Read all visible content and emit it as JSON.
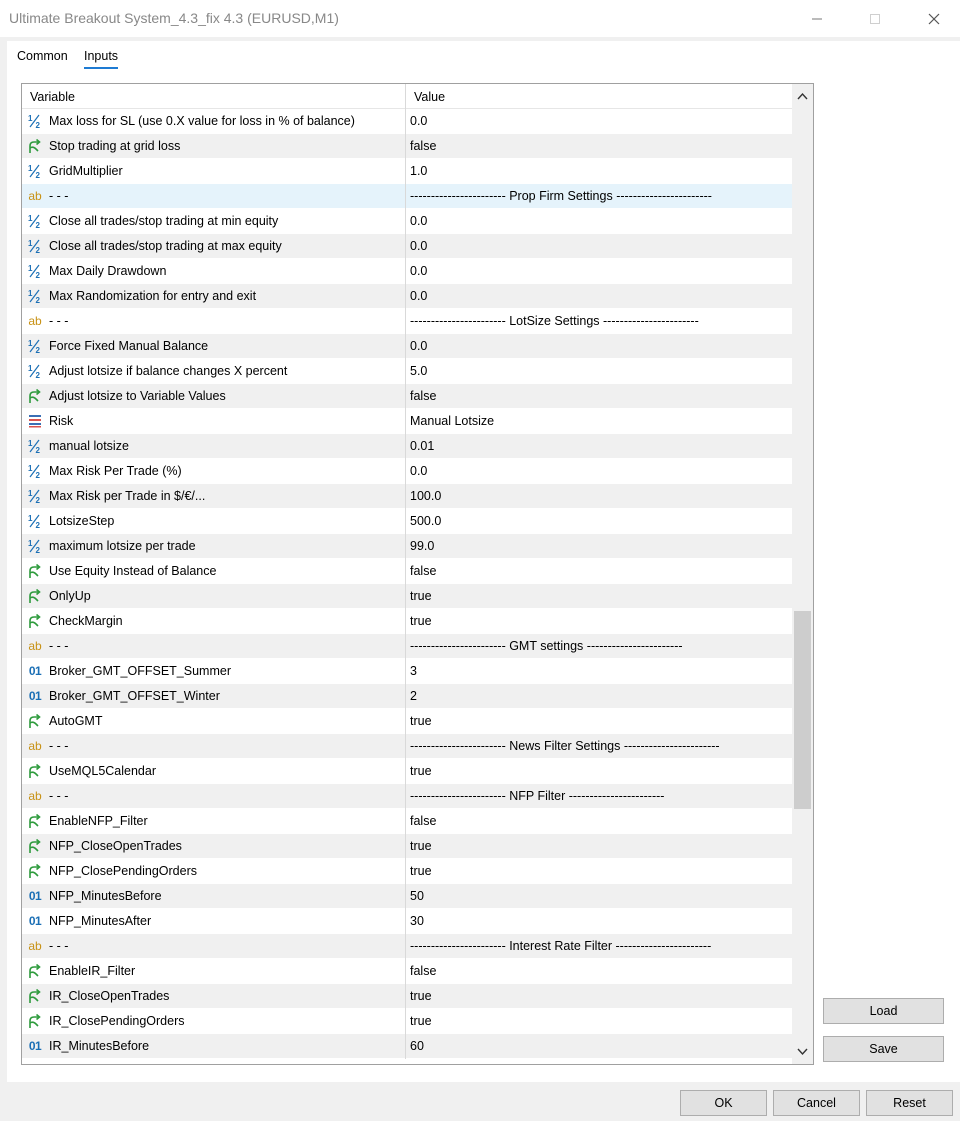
{
  "window": {
    "title": "Ultimate Breakout System_4.3_fix 4.3 (EURUSD,M1)"
  },
  "tabs": [
    {
      "label": "Common",
      "active": false
    },
    {
      "label": "Inputs",
      "active": true
    }
  ],
  "table": {
    "columns": [
      "Variable",
      "Value"
    ],
    "rows": [
      {
        "icon": "double",
        "name": "Max loss for SL (use 0.X value for loss in % of balance)",
        "value": "0.0"
      },
      {
        "icon": "bool",
        "name": "Stop trading at grid loss",
        "value": "false"
      },
      {
        "icon": "double",
        "name": "GridMultiplier",
        "value": "1.0"
      },
      {
        "icon": "string",
        "name": "- - -",
        "value": "----------------------- Prop Firm Settings -----------------------",
        "selected": true
      },
      {
        "icon": "double",
        "name": "Close all trades/stop trading at min equity",
        "value": "0.0"
      },
      {
        "icon": "double",
        "name": "Close all trades/stop trading at max equity",
        "value": "0.0"
      },
      {
        "icon": "double",
        "name": "Max Daily Drawdown",
        "value": "0.0"
      },
      {
        "icon": "double",
        "name": "Max Randomization for entry and exit",
        "value": "0.0"
      },
      {
        "icon": "string",
        "name": "- - -",
        "value": "----------------------- LotSize Settings -----------------------"
      },
      {
        "icon": "double",
        "name": "Force Fixed Manual Balance",
        "value": "0.0"
      },
      {
        "icon": "double",
        "name": "Adjust lotsize if balance changes X percent",
        "value": "5.0"
      },
      {
        "icon": "bool",
        "name": "Adjust lotsize to Variable Values",
        "value": "false"
      },
      {
        "icon": "enum",
        "name": "Risk",
        "value": "Manual Lotsize"
      },
      {
        "icon": "double",
        "name": "manual lotsize",
        "value": "0.01"
      },
      {
        "icon": "double",
        "name": "Max Risk Per Trade (%)",
        "value": "0.0"
      },
      {
        "icon": "double",
        "name": "Max Risk per Trade in $/€/...",
        "value": "100.0"
      },
      {
        "icon": "double",
        "name": "LotsizeStep",
        "value": "500.0"
      },
      {
        "icon": "double",
        "name": "maximum lotsize per trade",
        "value": "99.0"
      },
      {
        "icon": "bool",
        "name": "Use Equity Instead of Balance",
        "value": "false"
      },
      {
        "icon": "bool",
        "name": "OnlyUp",
        "value": "true"
      },
      {
        "icon": "bool",
        "name": "CheckMargin",
        "value": "true"
      },
      {
        "icon": "string",
        "name": "- - -",
        "value": "----------------------- GMT settings -----------------------"
      },
      {
        "icon": "int",
        "name": "Broker_GMT_OFFSET_Summer",
        "value": "3"
      },
      {
        "icon": "int",
        "name": "Broker_GMT_OFFSET_Winter",
        "value": "2"
      },
      {
        "icon": "bool",
        "name": "AutoGMT",
        "value": "true"
      },
      {
        "icon": "string",
        "name": "- - -",
        "value": "----------------------- News Filter Settings -----------------------"
      },
      {
        "icon": "bool",
        "name": "UseMQL5Calendar",
        "value": "true"
      },
      {
        "icon": "string",
        "name": "- - -",
        "value": "----------------------- NFP Filter -----------------------"
      },
      {
        "icon": "bool",
        "name": "EnableNFP_Filter",
        "value": "false"
      },
      {
        "icon": "bool",
        "name": "NFP_CloseOpenTrades",
        "value": "true"
      },
      {
        "icon": "bool",
        "name": "NFP_ClosePendingOrders",
        "value": "true"
      },
      {
        "icon": "int",
        "name": "NFP_MinutesBefore",
        "value": "50"
      },
      {
        "icon": "int",
        "name": "NFP_MinutesAfter",
        "value": "30"
      },
      {
        "icon": "string",
        "name": "- - -",
        "value": "----------------------- Interest Rate Filter -----------------------"
      },
      {
        "icon": "bool",
        "name": "EnableIR_Filter",
        "value": "false"
      },
      {
        "icon": "bool",
        "name": "IR_CloseOpenTrades",
        "value": "true"
      },
      {
        "icon": "bool",
        "name": "IR_ClosePendingOrders",
        "value": "true"
      },
      {
        "icon": "int",
        "name": "IR_MinutesBefore",
        "value": "60"
      }
    ]
  },
  "side_buttons": {
    "load": "Load",
    "save": "Save"
  },
  "footer_buttons": {
    "ok": "OK",
    "cancel": "Cancel",
    "reset": "Reset"
  },
  "colors": {
    "accent": "#1e7bd3",
    "double_icon": "#1b6fb5",
    "bool_icon": "#2e9b3d",
    "string_icon": "#c89215",
    "enum_icon_red": "#d9534f",
    "enum_icon_blue": "#3a6fb5",
    "selected_row": "#e5f3fb",
    "alt_row": "#f0f0f0"
  }
}
